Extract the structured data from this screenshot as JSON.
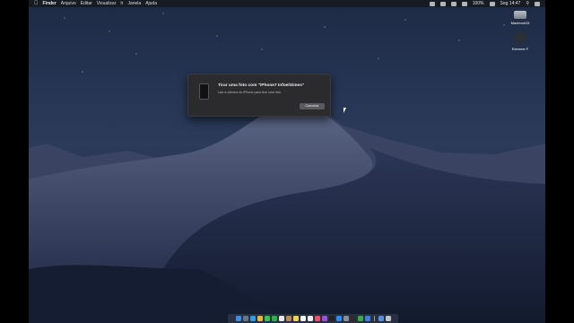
{
  "menubar": {
    "app_name": "Finder",
    "menus": [
      "Arquivo",
      "Editar",
      "Visualizar",
      "Ir",
      "Janela",
      "Ajuda"
    ],
    "battery": "100%",
    "clock": "Seg 14:47"
  },
  "desktop_icons": [
    {
      "label": "Macbook15",
      "icon": "hard-drive-icon"
    },
    {
      "label": "Extreme F",
      "icon": "external-drive-icon"
    }
  ],
  "dialog": {
    "title": "Tirar uma foto com \"iPhone7 InfoelSimes\"",
    "message": "Use a câmera do iPhone para tirar uma foto.",
    "button": "Cancelar"
  },
  "dock": {
    "apps": [
      {
        "name": "finder",
        "color": "#3d8ee8"
      },
      {
        "name": "launchpad",
        "color": "#6a7585"
      },
      {
        "name": "safari",
        "color": "#2d9fe8"
      },
      {
        "name": "chrome",
        "color": "#e8b83d"
      },
      {
        "name": "messages",
        "color": "#36c35a"
      },
      {
        "name": "facetime",
        "color": "#2fae4e"
      },
      {
        "name": "photos",
        "color": "#e8e8e8"
      },
      {
        "name": "contacts",
        "color": "#b58a5b"
      },
      {
        "name": "notes",
        "color": "#f0d35a"
      },
      {
        "name": "calendar",
        "color": "#f4f4f4"
      },
      {
        "name": "reminders",
        "color": "#eeeeee"
      },
      {
        "name": "music",
        "color": "#ef4f6a"
      },
      {
        "name": "podcasts",
        "color": "#9a52d9"
      },
      {
        "name": "tv",
        "color": "#222222"
      },
      {
        "name": "app-store",
        "color": "#2a8cf0"
      },
      {
        "name": "preferences",
        "color": "#8a8f98"
      },
      {
        "name": "terminal",
        "color": "#2b2b2b"
      },
      {
        "name": "numbers",
        "color": "#3aab4a"
      },
      {
        "name": "keynote",
        "color": "#3f7fe0"
      }
    ],
    "trailing": [
      {
        "name": "downloads",
        "color": "#5a8fd8"
      },
      {
        "name": "trash",
        "color": "#bfc4ca"
      }
    ]
  }
}
